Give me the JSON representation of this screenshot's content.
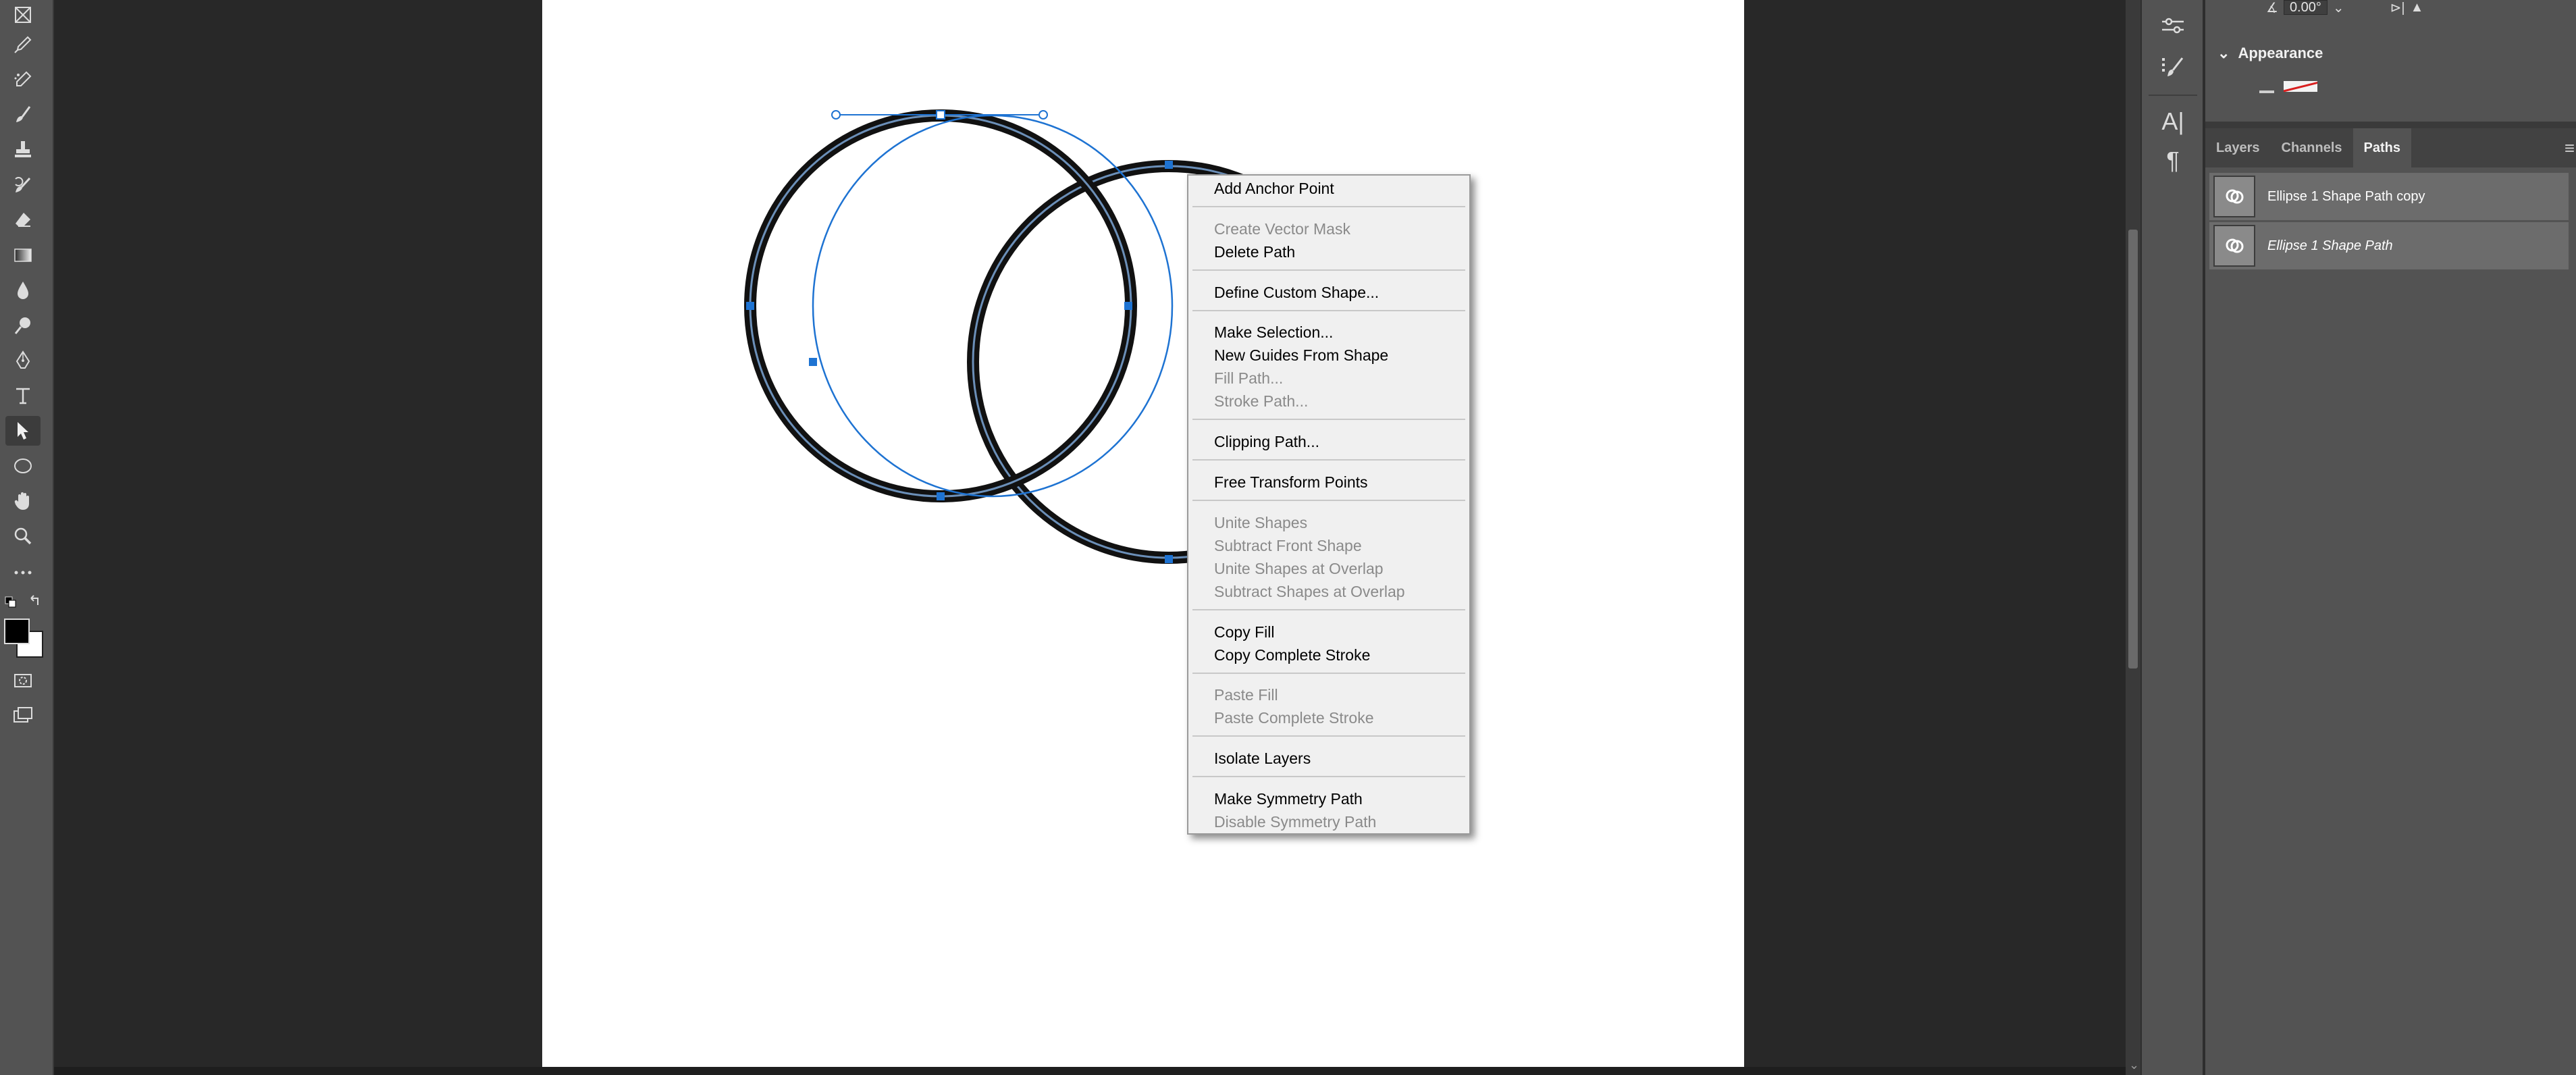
{
  "colors": {
    "app_bg": "#282828",
    "toolbar_bg": "#535353",
    "canvas_bg": "#ffffff",
    "selection_blue": "#1e73d2",
    "menu_bg": "#f0f0f0",
    "menu_disabled": "#8a8a8a"
  },
  "toolbar": {
    "tools": [
      {
        "name": "frame-tool-icon",
        "glyph": ""
      },
      {
        "name": "eyedropper-tool-icon",
        "glyph": ""
      },
      {
        "name": "spot-healing-brush-icon",
        "glyph": ""
      },
      {
        "name": "brush-tool-icon",
        "glyph": ""
      },
      {
        "name": "clone-stamp-icon",
        "glyph": ""
      },
      {
        "name": "history-brush-icon",
        "glyph": ""
      },
      {
        "name": "eraser-tool-icon",
        "glyph": ""
      },
      {
        "name": "gradient-tool-icon",
        "glyph": ""
      },
      {
        "name": "blur-tool-icon",
        "glyph": ""
      },
      {
        "name": "dodge-tool-icon",
        "glyph": ""
      },
      {
        "name": "pen-tool-icon",
        "glyph": ""
      },
      {
        "name": "type-tool-icon",
        "glyph": "T"
      },
      {
        "name": "path-selection-tool-icon",
        "glyph": ""
      },
      {
        "name": "ellipse-tool-icon",
        "glyph": ""
      },
      {
        "name": "hand-tool-icon",
        "glyph": ""
      },
      {
        "name": "zoom-tool-icon",
        "glyph": ""
      },
      {
        "name": "more-tools-icon",
        "glyph": "•••"
      }
    ]
  },
  "properties": {
    "angle_value": "0.00°",
    "appearance_label": "Appearance"
  },
  "midstrip": {
    "icons": [
      "adjustments-icon",
      "brush-settings-icon",
      "character-icon",
      "paragraph-icon"
    ],
    "character_glyph": "A|",
    "paragraph_glyph": "¶"
  },
  "panel": {
    "tabs": [
      {
        "label": "Layers",
        "active": false
      },
      {
        "label": "Channels",
        "active": false
      },
      {
        "label": "Paths",
        "active": true
      }
    ],
    "paths": [
      {
        "label": "Ellipse 1 Shape Path copy",
        "italic": false
      },
      {
        "label": "Ellipse 1 Shape Path",
        "italic": true
      }
    ]
  },
  "context_menu": {
    "items": [
      {
        "label": "Add Anchor Point",
        "disabled": false
      },
      {
        "sep": true
      },
      {
        "label": "Create Vector Mask",
        "disabled": true
      },
      {
        "label": "Delete Path",
        "disabled": false
      },
      {
        "sep": true
      },
      {
        "label": "Define Custom Shape...",
        "disabled": false
      },
      {
        "sep": true
      },
      {
        "label": "Make Selection...",
        "disabled": false
      },
      {
        "label": "New Guides From Shape",
        "disabled": false
      },
      {
        "label": "Fill Path...",
        "disabled": true
      },
      {
        "label": "Stroke Path...",
        "disabled": true
      },
      {
        "sep": true
      },
      {
        "label": "Clipping Path...",
        "disabled": false
      },
      {
        "sep": true
      },
      {
        "label": "Free Transform Points",
        "disabled": false
      },
      {
        "sep": true
      },
      {
        "label": "Unite Shapes",
        "disabled": true
      },
      {
        "label": "Subtract Front Shape",
        "disabled": true
      },
      {
        "label": "Unite Shapes at Overlap",
        "disabled": true
      },
      {
        "label": "Subtract Shapes at Overlap",
        "disabled": true
      },
      {
        "sep": true
      },
      {
        "label": "Copy Fill",
        "disabled": false
      },
      {
        "label": "Copy Complete Stroke",
        "disabled": false
      },
      {
        "sep": true
      },
      {
        "label": "Paste Fill",
        "disabled": true
      },
      {
        "label": "Paste Complete Stroke",
        "disabled": true
      },
      {
        "sep": true
      },
      {
        "label": "Isolate Layers",
        "disabled": false
      },
      {
        "sep": true
      },
      {
        "label": "Make Symmetry Path",
        "disabled": false
      },
      {
        "label": "Disable Symmetry Path",
        "disabled": true
      }
    ]
  }
}
